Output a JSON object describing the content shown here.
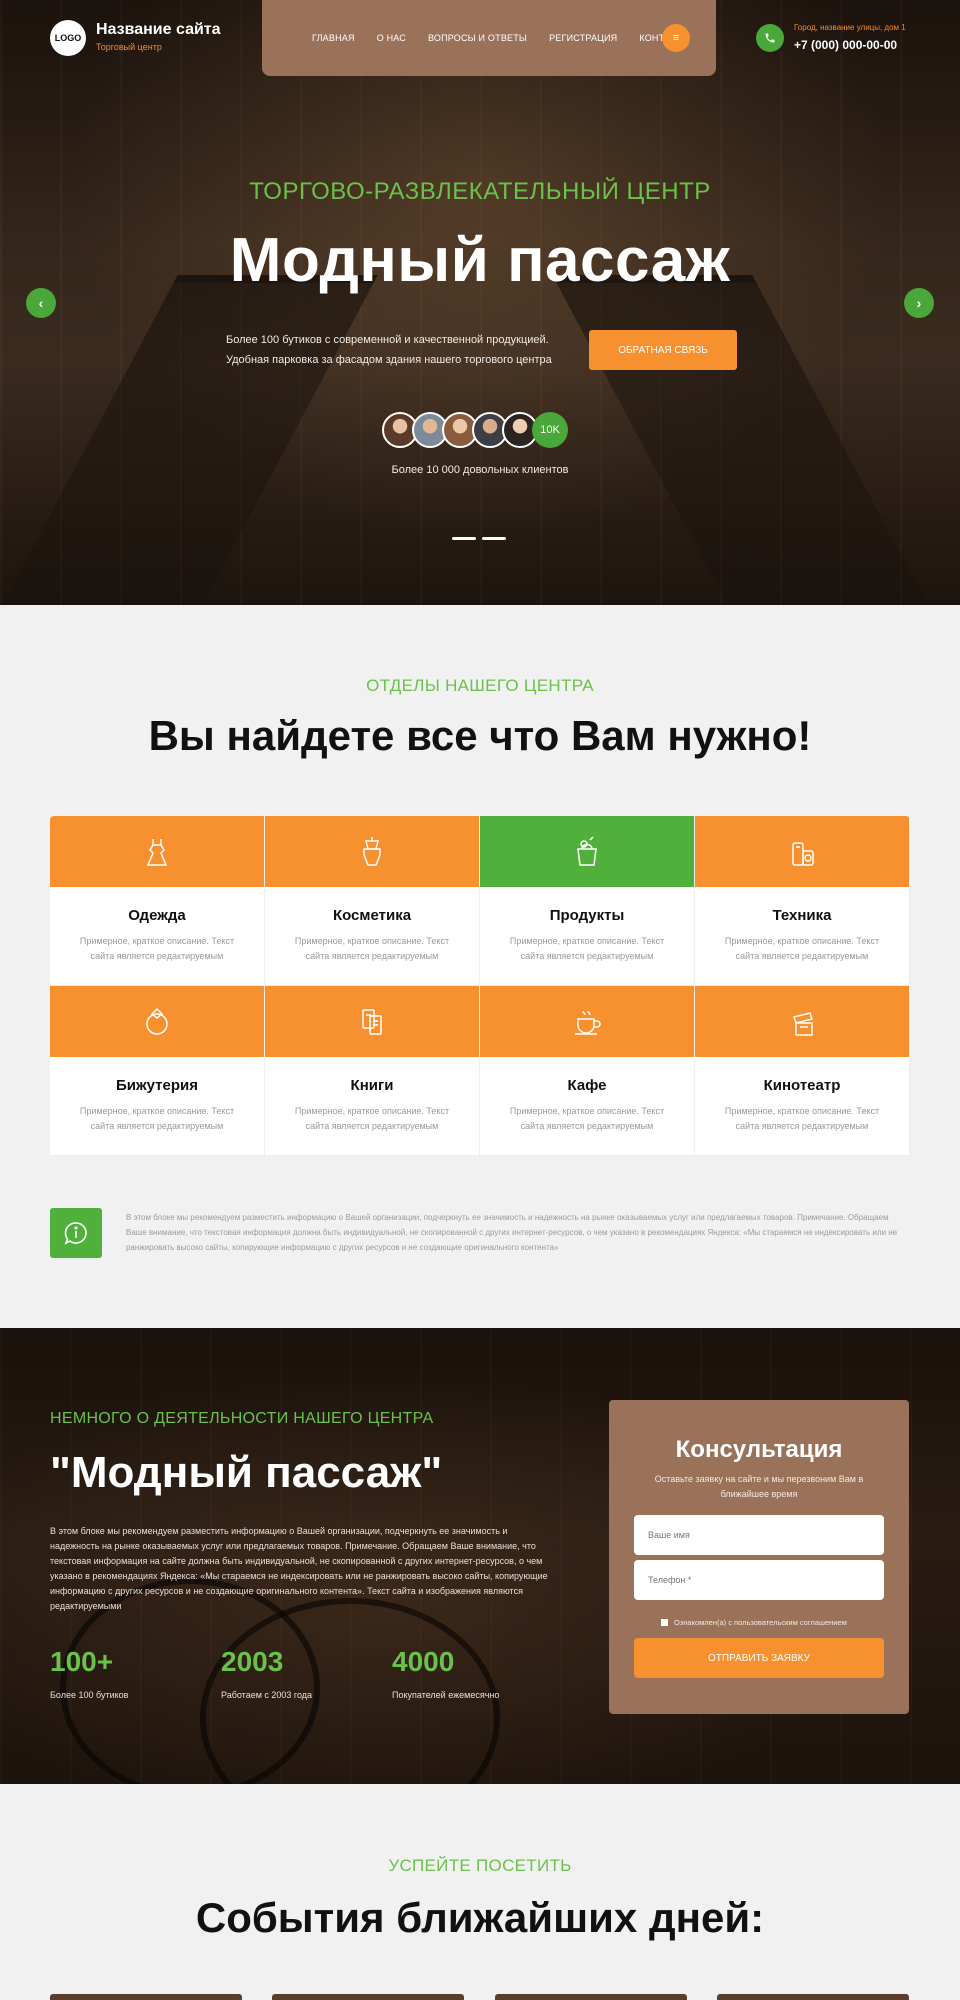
{
  "header": {
    "logo": "LOGO",
    "site_name": "Название сайта",
    "site_sub": "Торговый центр",
    "nav": [
      "ГЛАВНАЯ",
      "О НАС",
      "ВОПРОСЫ И ОТВЕТЫ",
      "РЕГИСТРАЦИЯ",
      "КОНТАКТЫ"
    ],
    "menu_icon": "≡",
    "address": "Город, название улицы, дом 1",
    "phone": "+7 (000) 000-00-00"
  },
  "hero": {
    "kicker": "ТОРГОВО-РАЗВЛЕКАТЕЛЬНЫЙ ЦЕНТР",
    "title": "Модный пассаж",
    "text_line1": "Более 100 бутиков с современной и качественной продукцией.",
    "text_line2": "Удобная парковка за фасадом здания нашего торгового центра",
    "cta": "ОБРАТНАЯ СВЯЗЬ",
    "avatar_count": "10K",
    "clients": "Более 10 000 довольных клиентов",
    "prev": "‹",
    "next": "›"
  },
  "departments": {
    "kicker": "ОТДЕЛЫ НАШЕГО ЦЕНТРА",
    "title": "Вы найдете все что Вам нужно!",
    "desc_line1": "Примерное, краткое описание. Текст",
    "desc_line2": "сайта является редактируемым",
    "items": [
      {
        "name": "Одежда",
        "icon": "dress-icon"
      },
      {
        "name": "Косметика",
        "icon": "cosmetics-icon"
      },
      {
        "name": "Продукты",
        "icon": "groceries-icon"
      },
      {
        "name": "Техника",
        "icon": "appliances-icon"
      },
      {
        "name": "Бижутерия",
        "icon": "jewelry-icon"
      },
      {
        "name": "Книги",
        "icon": "books-icon"
      },
      {
        "name": "Кафе",
        "icon": "coffee-icon"
      },
      {
        "name": "Кинотеатр",
        "icon": "cinema-icon"
      }
    ],
    "info_text": "В этом блоке мы рекомендуем разместить информацию о Вашей организации, подчеркнуть ее значимость и надежность на рынке оказываемых услуг или предлагаемых товаров. Примечание. Обращаем Ваше внимание, что текстовая информация должна быть индивидуальной, не скопированной с других интернет-ресурсов, о чем указано в рекомендациях Яндекса: «Мы стараемся не индексировать или не ранжировать высоко сайты, копирующие информацию с других ресурсов и не создающие оригинального контента»"
  },
  "about": {
    "kicker": "НЕМНОГО О ДЕЯТЕЛЬНОСТИ НАШЕГО ЦЕНТРА",
    "title": "\"Модный пассаж\"",
    "text": "В этом блоке мы рекомендуем разместить информацию о Вашей организации, подчеркнуть ее значимость и надежность на рынке оказываемых услуг или предлагаемых товаров. Примечание. Обращаем Ваше внимание, что текстовая информация на сайте должна быть индивидуальной, не скопированной с других интернет-ресурсов, о чем указано в рекомендациях Яндекса: «Мы стараемся не индексировать или не ранжировать высоко сайты, копирующие информацию с других ресурсов и не создающие оригинального контента». Текст сайта и изображения являются редактируемыми",
    "stats": [
      {
        "value": "100+",
        "label": "Более 100 бутиков"
      },
      {
        "value": "2003",
        "label": "Работаем с 2003 года"
      },
      {
        "value": "4000",
        "label": "Покупателей ежемесячно"
      }
    ]
  },
  "form": {
    "title": "Консультация",
    "subtitle": "Оставьте заявку на сайте и мы перезвоним Вам в ближайшее время",
    "name_placeholder": "Ваше имя",
    "phone_placeholder": "Телефон *",
    "agree": "Ознакомлен(а) с пользовательским соглашением",
    "submit": "ОТПРАВИТЬ ЗАЯВКУ"
  },
  "events": {
    "kicker": "УСПЕЙТЕ ПОСЕТИТЬ",
    "title": "События ближайших дней:"
  },
  "colors": {
    "accent_orange": "#f7902e",
    "accent_green": "#4fb03c",
    "brown": "#9a7259"
  }
}
